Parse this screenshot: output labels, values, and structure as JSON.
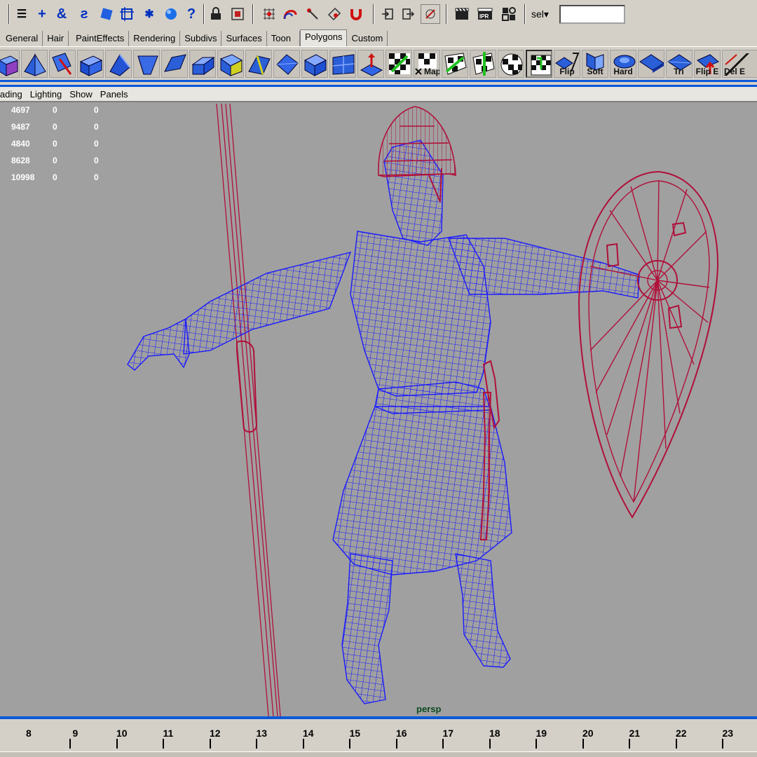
{
  "status_line": {
    "icons": [
      "menu-set-icon",
      "move-plus-icon",
      "lasso-icon",
      "curve-icon",
      "component-mode-icon",
      "pivot-icon",
      "object-star-icon",
      "sphere-icon",
      "help-icon",
      "lock-selection-icon",
      "highlight-icon",
      "snap-grid-icon",
      "snap-curve-icon",
      "snap-point-icon",
      "snap-view-icon",
      "snap-magnet-icon",
      "input-icon",
      "output-icon",
      "history-icon",
      "render-icon",
      "ipr-render-icon",
      "render-settings-icon"
    ],
    "sel_label": "sel",
    "sel_value": ""
  },
  "shelf_tabs": [
    "General",
    "Hair",
    "PaintEffects",
    "Rendering",
    "Subdivs",
    "Surfaces",
    "Toon",
    "Polygons",
    "Custom"
  ],
  "active_tab": "Polygons",
  "shelf": {
    "labels": {
      "map": "Map",
      "flip": "Flip",
      "soft": "Soft",
      "hard": "Hard",
      "tri": "Tri",
      "flip_e": "Flip E",
      "del_e": "Del E"
    }
  },
  "panel_menu": [
    "Shading",
    "Lighting",
    "Show",
    "Panels"
  ],
  "poly_count": [
    [
      "4697",
      "0",
      "0"
    ],
    [
      "9487",
      "0",
      "0"
    ],
    [
      "4840",
      "0",
      "0"
    ],
    [
      "8628",
      "0",
      "0"
    ],
    [
      "10998",
      "0",
      "0"
    ]
  ],
  "camera_label": "persp",
  "time_slider": {
    "frames": [
      "8",
      "9",
      "10",
      "11",
      "12",
      "13",
      "14",
      "15",
      "16",
      "17",
      "18",
      "19",
      "20",
      "21",
      "22",
      "23"
    ]
  },
  "colors": {
    "wire_blue": "#1a1aff",
    "wire_red": "#b0103a",
    "viewport_bg": "#a0a0a0",
    "ui_bg": "#d4d0c8",
    "accent_blue": "#0a58d8"
  }
}
